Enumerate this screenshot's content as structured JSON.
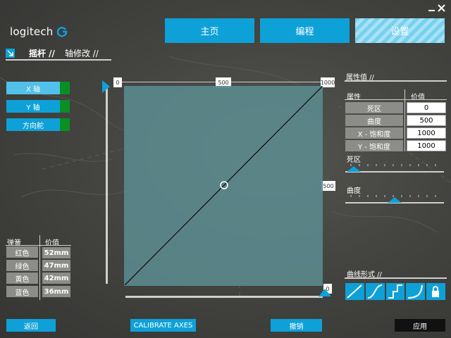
{
  "brand": {
    "logo_text": "logitech"
  },
  "nav": {
    "home": "主页",
    "program": "编程",
    "settings": "设置"
  },
  "breadcrumb": {
    "crumb1": "摇杆 //",
    "crumb2": "轴修改 //"
  },
  "axes": {
    "x": "X 轴",
    "y": "Y 轴",
    "rudder": "方向舵"
  },
  "graph": {
    "top_left": "0",
    "top_mid": "500",
    "top_right": "1000",
    "right_mid": "500",
    "right_bottom": "0"
  },
  "springs": {
    "col1": "弹簧",
    "col2": "价值",
    "rows": [
      {
        "name": "红色",
        "value": "52mm"
      },
      {
        "name": "绿色",
        "value": "47mm"
      },
      {
        "name": "黄色",
        "value": "42mm"
      },
      {
        "name": "蓝色",
        "value": "36mm"
      }
    ]
  },
  "props": {
    "title": "属性值 //",
    "col1": "属性",
    "col2": "价值",
    "rows": [
      {
        "name": "死区",
        "value": "0"
      },
      {
        "name": "曲度",
        "value": "500"
      },
      {
        "name": "X - 饱和度",
        "value": "1000"
      },
      {
        "name": "Y - 饱和度",
        "value": "1000"
      }
    ],
    "deadzone_label": "死区",
    "curve_label": "曲度",
    "deadzone_level": 0.0,
    "curve_level": 0.5
  },
  "curve_shape": {
    "title": "曲线形式 //"
  },
  "buttons": {
    "back": "返回",
    "calibrate": "CALIBRATE AXES",
    "undo": "撤销",
    "apply": "应用"
  },
  "colors": {
    "accent": "#0ea1d8",
    "axis_indicator": "#0a8f23",
    "graph_bg": "#5d8d92"
  }
}
